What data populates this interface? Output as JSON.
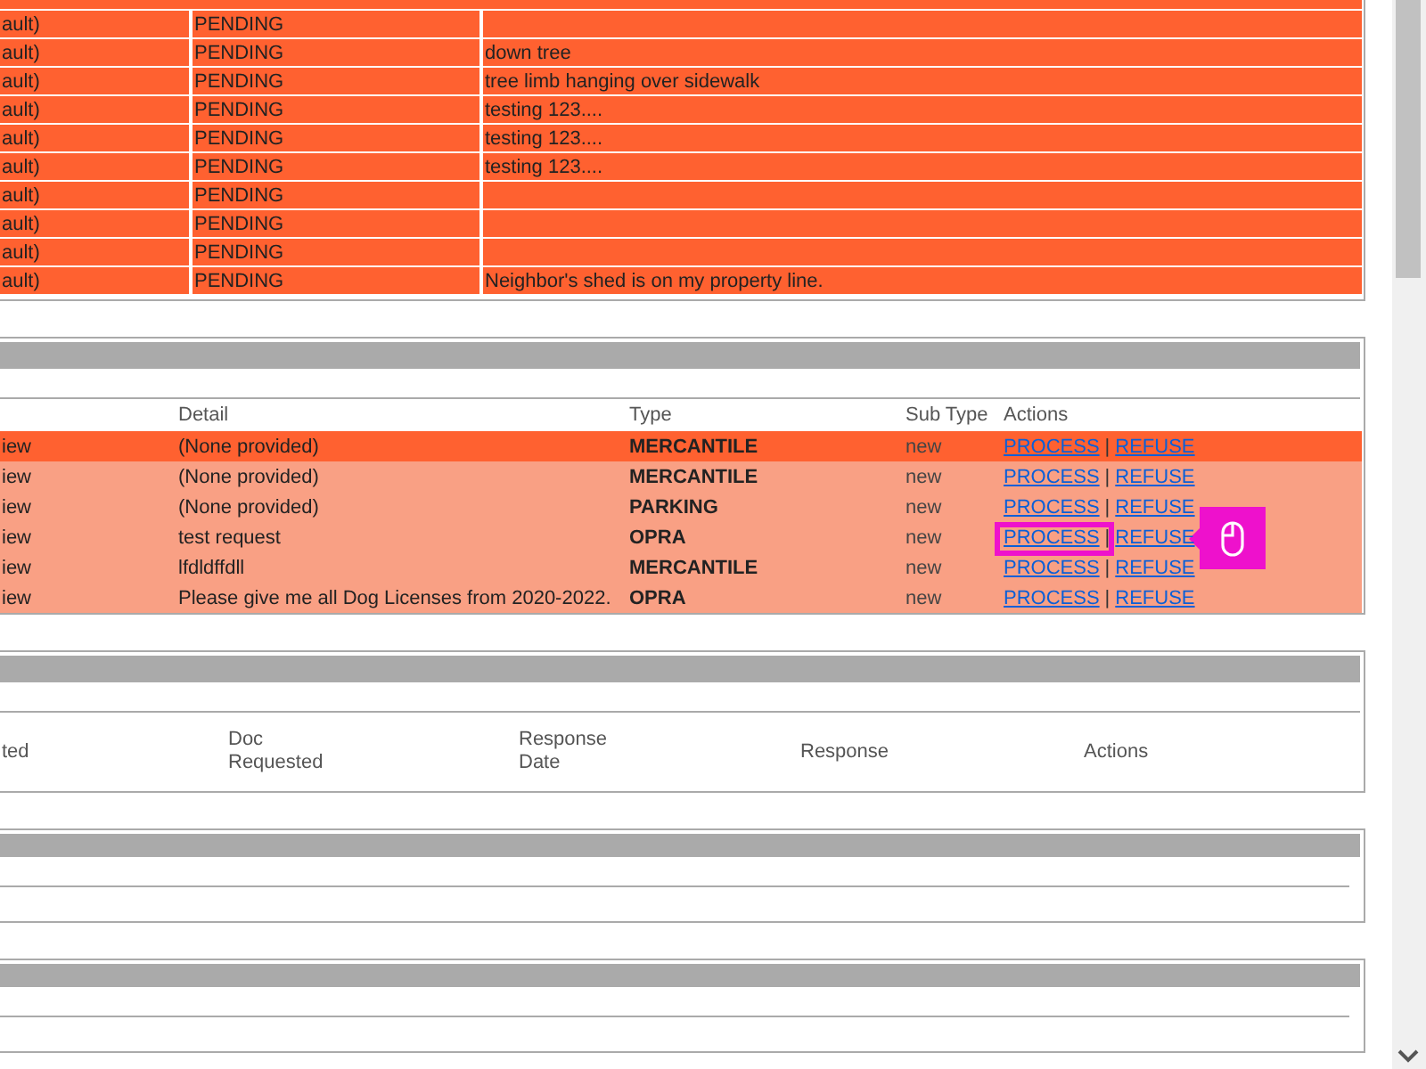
{
  "panels": [
    {
      "kind": "status_table",
      "rows": [
        {
          "column_1": "ault)",
          "column_2": "PENDING"
        },
        {
          "column_1": "ault)",
          "column_2": "PENDING",
          "column_3": "down tree"
        },
        {
          "column_1": "ault)",
          "column_2": "PENDING",
          "column_3": "tree limb hanging over sidewalk"
        },
        {
          "column_1": "ault)",
          "column_2": "PENDING",
          "column_3": "testing 123...."
        },
        {
          "column_1": "ault)",
          "column_2": "PENDING",
          "column_3": "testing 123...."
        },
        {
          "column_1": "ault)",
          "column_2": "PENDING",
          "column_3": "testing 123...."
        },
        {
          "column_1": "ault)",
          "column_2": "PENDING"
        },
        {
          "column_1": "ault)",
          "column_2": "PENDING"
        },
        {
          "column_1": "ault)",
          "column_2": "PENDING"
        },
        {
          "column_1": "ault)",
          "column_2": "PENDING",
          "column_3": "Neighbor's shed is on my property line."
        }
      ]
    },
    {
      "kind": "requests",
      "columns": [
        "Detail",
        "Type",
        "Sub Type",
        "Actions"
      ],
      "separator": "|",
      "rows": [
        {
          "column_1": "iew",
          "detail": "(None provided)",
          "type": "MERCANTILE",
          "sub_type": "new",
          "selected": true,
          "actions": [
            {
              "label": "PROCESS",
              "highlighted": false
            },
            {
              "label": "REFUSE",
              "highlighted": false
            }
          ]
        },
        {
          "column_1": "iew",
          "detail": "(None provided)",
          "type": "MERCANTILE",
          "sub_type": "new",
          "selected": false,
          "actions": [
            {
              "label": "PROCESS",
              "highlighted": false
            },
            {
              "label": "REFUSE",
              "highlighted": false
            }
          ]
        },
        {
          "column_1": "iew",
          "detail": "(None provided)",
          "type": "PARKING",
          "sub_type": "new",
          "selected": false,
          "actions": [
            {
              "label": "PROCESS",
              "highlighted": false
            },
            {
              "label": "REFUSE",
              "highlighted": false
            }
          ]
        },
        {
          "column_1": "iew",
          "detail": "test request",
          "type": "OPRA",
          "sub_type": "new",
          "selected": false,
          "actions": [
            {
              "label": "PROCESS",
              "highlighted": true
            },
            {
              "label": "REFUSE",
              "highlighted": false
            }
          ]
        },
        {
          "column_1": "iew",
          "detail": "lfdldffdll",
          "type": "MERCANTILE",
          "sub_type": "new",
          "selected": false,
          "actions": [
            {
              "label": "PROCESS",
              "highlighted": false
            },
            {
              "label": "REFUSE",
              "highlighted": false
            }
          ]
        },
        {
          "column_1": "iew",
          "detail": "Please give me all Dog Licenses from 2020-2022.",
          "type": "OPRA",
          "sub_type": "new",
          "selected": false,
          "actions": [
            {
              "label": "PROCESS",
              "highlighted": false
            },
            {
              "label": "REFUSE",
              "highlighted": false
            }
          ]
        }
      ]
    },
    {
      "kind": "responses",
      "columns": [
        "ted",
        "Doc\nRequested",
        "Response\nDate",
        "Response",
        "Actions"
      ]
    },
    {
      "kind": "empty"
    },
    {
      "kind": "empty"
    }
  ]
}
